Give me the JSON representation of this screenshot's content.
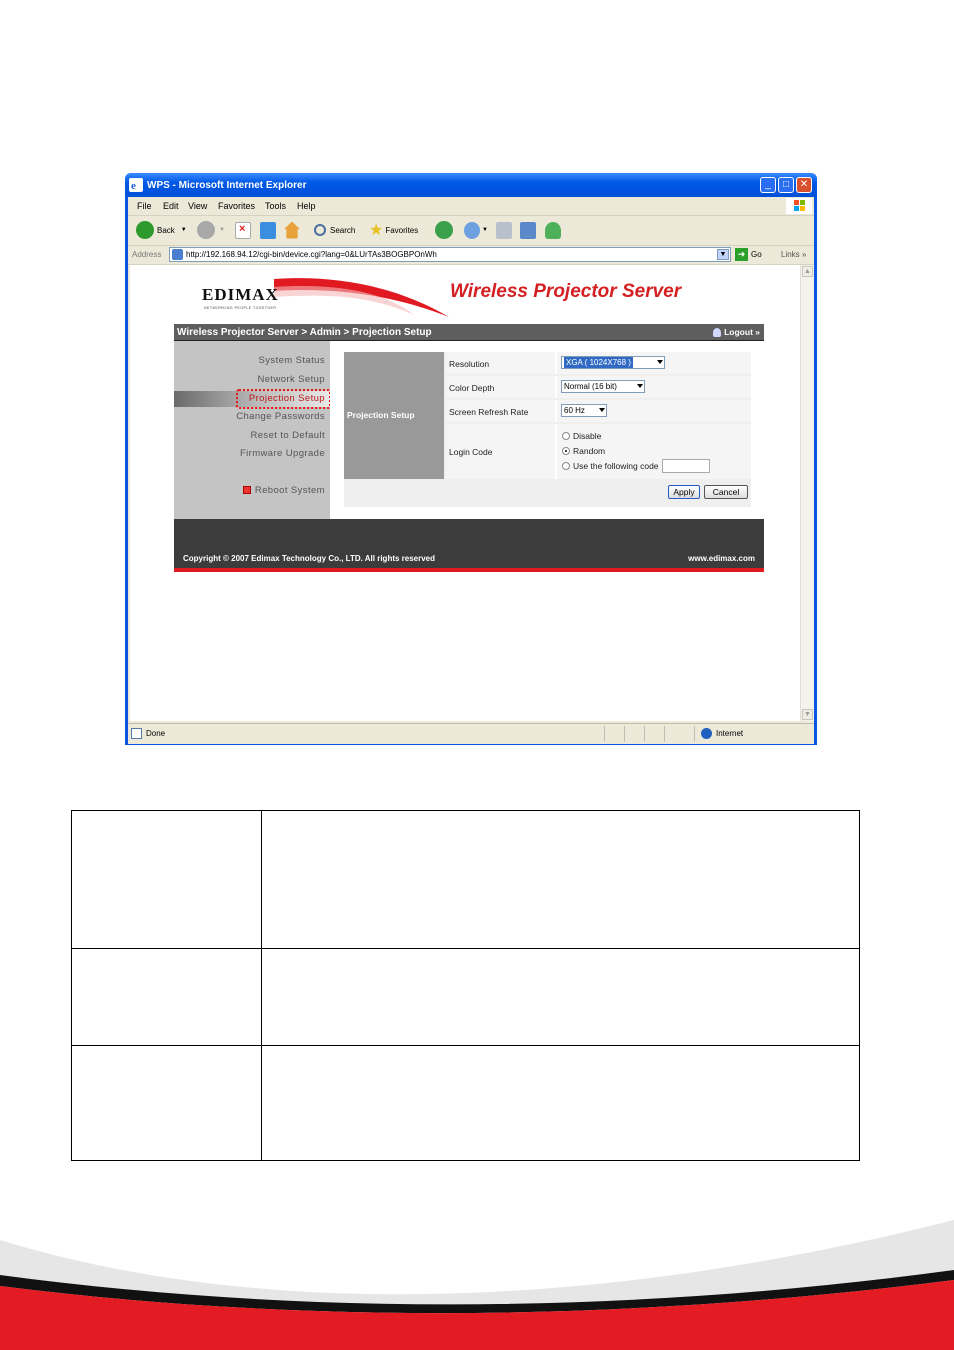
{
  "window": {
    "title": "WPS - Microsoft Internet Explorer",
    "buttons": {
      "minimize": "_",
      "maximize": "□",
      "close": "✕"
    }
  },
  "menu": [
    "File",
    "Edit",
    "View",
    "Favorites",
    "Tools",
    "Help"
  ],
  "toolbar": {
    "back": "Back",
    "search": "Search",
    "favorites": "Favorites"
  },
  "address": {
    "label": "Address",
    "url": "http://192.168.94.12/cgi-bin/device.cgi?lang=0&LUrTAs3BOGBPOnWh",
    "go": "Go",
    "links": "Links"
  },
  "status": {
    "text": "Done",
    "zone": "Internet"
  },
  "page": {
    "logo": "EDIMAX",
    "logo_tagline": "NETWORKING PEOPLE TOGETHER",
    "product": "Wireless Projector Server",
    "breadcrumb": "Wireless Projector Server > Admin > Projection Setup",
    "logout": "Logout »",
    "sidebar": [
      "System Status",
      "Network Setup",
      "Projection Setup",
      "Change Passwords",
      "Reset to Default",
      "Firmware Upgrade",
      "Reboot System"
    ],
    "section": "Projection Setup",
    "fields": {
      "resolution_label": "Resolution",
      "resolution_value": "XGA ( 1024X768 )",
      "color_depth_label": "Color Depth",
      "color_depth_value": "Normal (16 bit)",
      "refresh_label": "Screen Refresh Rate",
      "refresh_value": "60 Hz",
      "login_code_label": "Login Code",
      "login_options": [
        "Disable",
        "Random",
        "Use the following code"
      ],
      "login_selected": "Random"
    },
    "apply": "Apply",
    "cancel": "Cancel",
    "copyright": "Copyright © 2007 Edimax Technology Co., LTD. All rights reserved",
    "site": "www.edimax.com"
  },
  "colors": {
    "xp_blue": "#0058e6",
    "brand_red": "#d42022",
    "nav_gray": "#5e5e5e",
    "highlight": "#ee1111"
  }
}
